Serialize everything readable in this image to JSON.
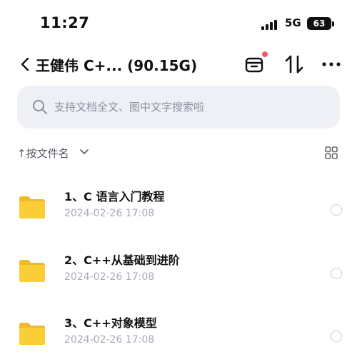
{
  "status_bar": {
    "time": "11:27",
    "network": "5G",
    "battery": "63"
  },
  "header": {
    "title": "王健伟 C+... (90.15G)",
    "icons": [
      "back-icon",
      "inbox-icon",
      "sort-icon",
      "more-icon"
    ]
  },
  "search": {
    "placeholder": "支持文档全文、图中文字搜索啦"
  },
  "sort": {
    "label": "↑按文件名"
  },
  "files": [
    {
      "name": "1、C 语言入门教程",
      "date": "2024-02-26 17:08"
    },
    {
      "name": "2、C++从基础到进阶",
      "date": "2024-02-26 17:08"
    },
    {
      "name": "3、C++对象模型",
      "date": "2024-02-26 17:08"
    }
  ],
  "colors": {
    "folder": "#fbcd36",
    "search_bg": "#eef0f6",
    "notification_dot": "#f25b5b",
    "secondary_text": "#a8abb5"
  }
}
